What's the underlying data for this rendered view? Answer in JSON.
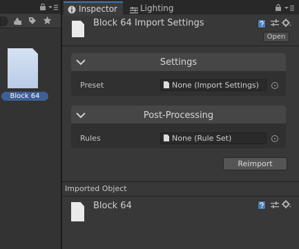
{
  "project_panel": {
    "asset": {
      "name": "Block 64",
      "selected": true
    }
  },
  "tabs": [
    {
      "label": "Inspector",
      "icon": "info-icon",
      "active": true
    },
    {
      "label": "Lighting",
      "icon": "lighting-icon",
      "active": false
    }
  ],
  "header": {
    "title": "Block 64 Import Settings",
    "open_button": "Open"
  },
  "sections": [
    {
      "title": "Settings",
      "expanded": true,
      "row": {
        "label": "Preset",
        "value": "None (Import Settings)"
      }
    },
    {
      "title": "Post-Processing",
      "expanded": true,
      "row": {
        "label": "Rules",
        "value": "None (Rule Set)"
      }
    }
  ],
  "reimport_button": "Reimport",
  "imported_object": {
    "label": "Imported Object",
    "name": "Block 64"
  },
  "colors": {
    "accent": "#3a79bb",
    "selection": "#3e5f96",
    "panel_bg": "#383838"
  }
}
